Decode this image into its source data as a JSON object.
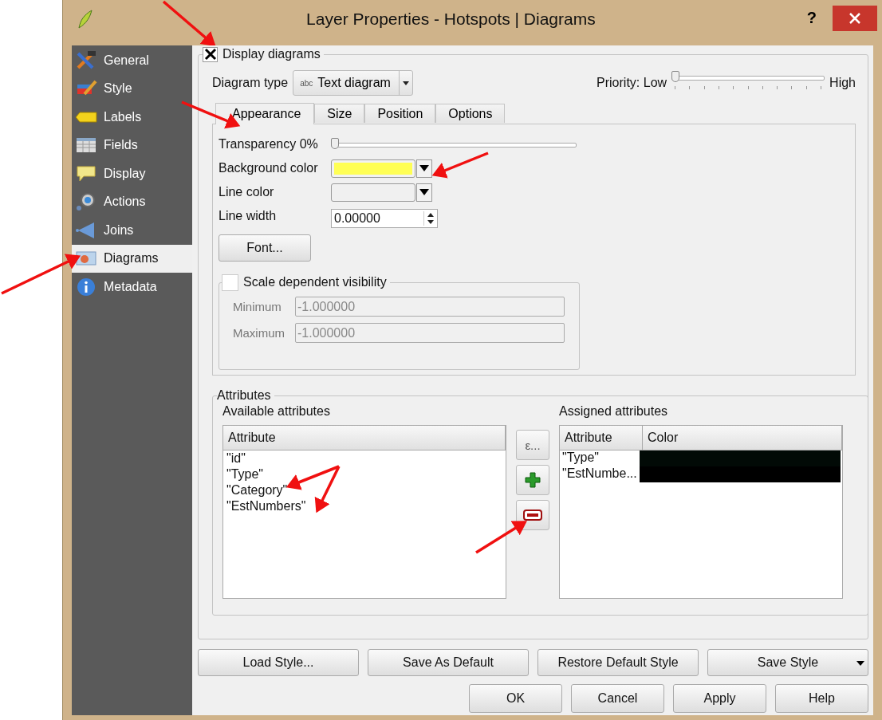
{
  "window": {
    "title": "Layer Properties - Hotspots | Diagrams",
    "help": "?"
  },
  "sidebar": {
    "items": [
      {
        "label": "General",
        "selected": false
      },
      {
        "label": "Style",
        "selected": false
      },
      {
        "label": "Labels",
        "selected": false
      },
      {
        "label": "Fields",
        "selected": false
      },
      {
        "label": "Display",
        "selected": false
      },
      {
        "label": "Actions",
        "selected": false
      },
      {
        "label": "Joins",
        "selected": false
      },
      {
        "label": "Diagrams",
        "selected": true
      },
      {
        "label": "Metadata",
        "selected": false
      }
    ]
  },
  "display_diagrams": {
    "label": "Display diagrams",
    "checked": true
  },
  "diagram_type": {
    "label": "Diagram type",
    "badge": "abc",
    "value": "Text diagram"
  },
  "priority": {
    "label": "Priority: Low",
    "high": "High",
    "level": 0
  },
  "tabs": [
    {
      "label": "Appearance",
      "selected": true
    },
    {
      "label": "Size",
      "selected": false
    },
    {
      "label": "Position",
      "selected": false
    },
    {
      "label": "Options",
      "selected": false
    }
  ],
  "appearance": {
    "transparency": {
      "label": "Transparency 0%",
      "level": 0
    },
    "background_color": {
      "label": "Background color",
      "color": "#ffff55"
    },
    "line_color": {
      "label": "Line color",
      "color": "#f0f0f0"
    },
    "line_width": {
      "label": "Line width",
      "value": "0.00000"
    },
    "font_button": "Font...",
    "scale_visibility": {
      "label": "Scale dependent visibility",
      "checked": false,
      "fields": [
        {
          "label": "Minimum",
          "value": "-1.000000",
          "disabled": true
        },
        {
          "label": "Maximum",
          "value": "-1.000000",
          "disabled": true
        }
      ]
    }
  },
  "attributes": {
    "title": "Attributes",
    "available": {
      "title": "Available attributes",
      "header": "Attribute",
      "items": [
        "\"id\"",
        "\"Type\"",
        "\"Category\"",
        "\"EstNumbers\""
      ]
    },
    "expression_button": "ε...",
    "assigned": {
      "title": "Assigned attributes",
      "headers": [
        "Attribute",
        "Color"
      ],
      "rows": [
        {
          "name": "\"Type\"",
          "color": "#020a06"
        },
        {
          "name": "\"EstNumbe...",
          "color": "#000000"
        }
      ]
    }
  },
  "style_buttons": [
    "Load Style...",
    "Save As Default",
    "Restore Default Style",
    "Save Style"
  ],
  "dialog_buttons": [
    "OK",
    "Cancel",
    "Apply",
    "Help"
  ]
}
